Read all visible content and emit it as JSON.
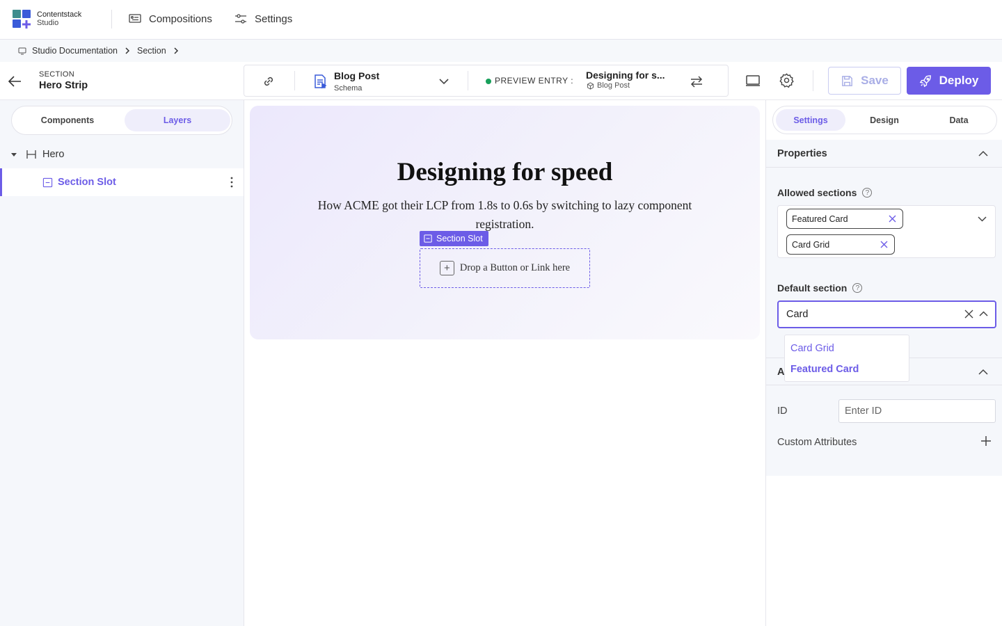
{
  "colors": {
    "accent": "#6c5ce7",
    "success": "#18a05b",
    "logo_blue": "#3a5bd9",
    "logo_teal": "#3f8d8e"
  },
  "brand": {
    "name": "Contentstack",
    "product": "Studio"
  },
  "topnav": {
    "compositions": "Compositions",
    "settings": "Settings"
  },
  "breadcrumb": {
    "items": [
      "Studio Documentation",
      "Section"
    ]
  },
  "header": {
    "section_label": "SECTION",
    "section_name": "Hero Strip",
    "schema_title": "Blog Post",
    "schema_subtitle": "Schema",
    "preview_label": "PREVIEW ENTRY :",
    "preview_title": "Designing for s...",
    "preview_subtitle": "Blog Post",
    "save_label": "Save",
    "deploy_label": "Deploy"
  },
  "left_panel": {
    "tabs": [
      "Components",
      "Layers"
    ],
    "active_tab": "Layers",
    "tree": [
      {
        "label": "Hero",
        "level": 0
      },
      {
        "label": "Section Slot",
        "level": 1,
        "selected": true
      }
    ]
  },
  "canvas": {
    "hero_title": "Designing for speed",
    "hero_subtitle": "How ACME got their LCP from 1.8s to 0.6s by switching to lazy component registration.",
    "slot_tag": "Section Slot",
    "drop_text": "Drop a Button or Link here"
  },
  "right_panel": {
    "tabs": [
      "Settings",
      "Design",
      "Data"
    ],
    "active_tab": "Settings",
    "properties_title": "Properties",
    "allowed_sections_label": "Allowed sections",
    "allowed_sections": [
      "Featured Card",
      "Card Grid"
    ],
    "default_section_label": "Default section",
    "default_section_value": "Card",
    "dropdown_options": [
      "Card Grid",
      "Featured Card"
    ],
    "attributes_title_initial": "A",
    "id_label": "ID",
    "id_placeholder": "Enter ID",
    "custom_attributes_label": "Custom Attributes"
  },
  "icons": [
    "compositions-icon",
    "settings-sliders-icon",
    "breadcrumb-home-icon",
    "chevron-right-icon",
    "back-arrow-icon",
    "link-icon",
    "schema-doc-icon",
    "chevron-down-icon",
    "swap-icon",
    "monitor-icon",
    "gear-icon",
    "save-disk-icon",
    "rocket-icon",
    "caret-down-icon",
    "hero-layout-icon",
    "slot-icon",
    "more-vertical-icon",
    "plus-icon",
    "help-circle-icon",
    "close-icon",
    "chevron-up-icon"
  ]
}
